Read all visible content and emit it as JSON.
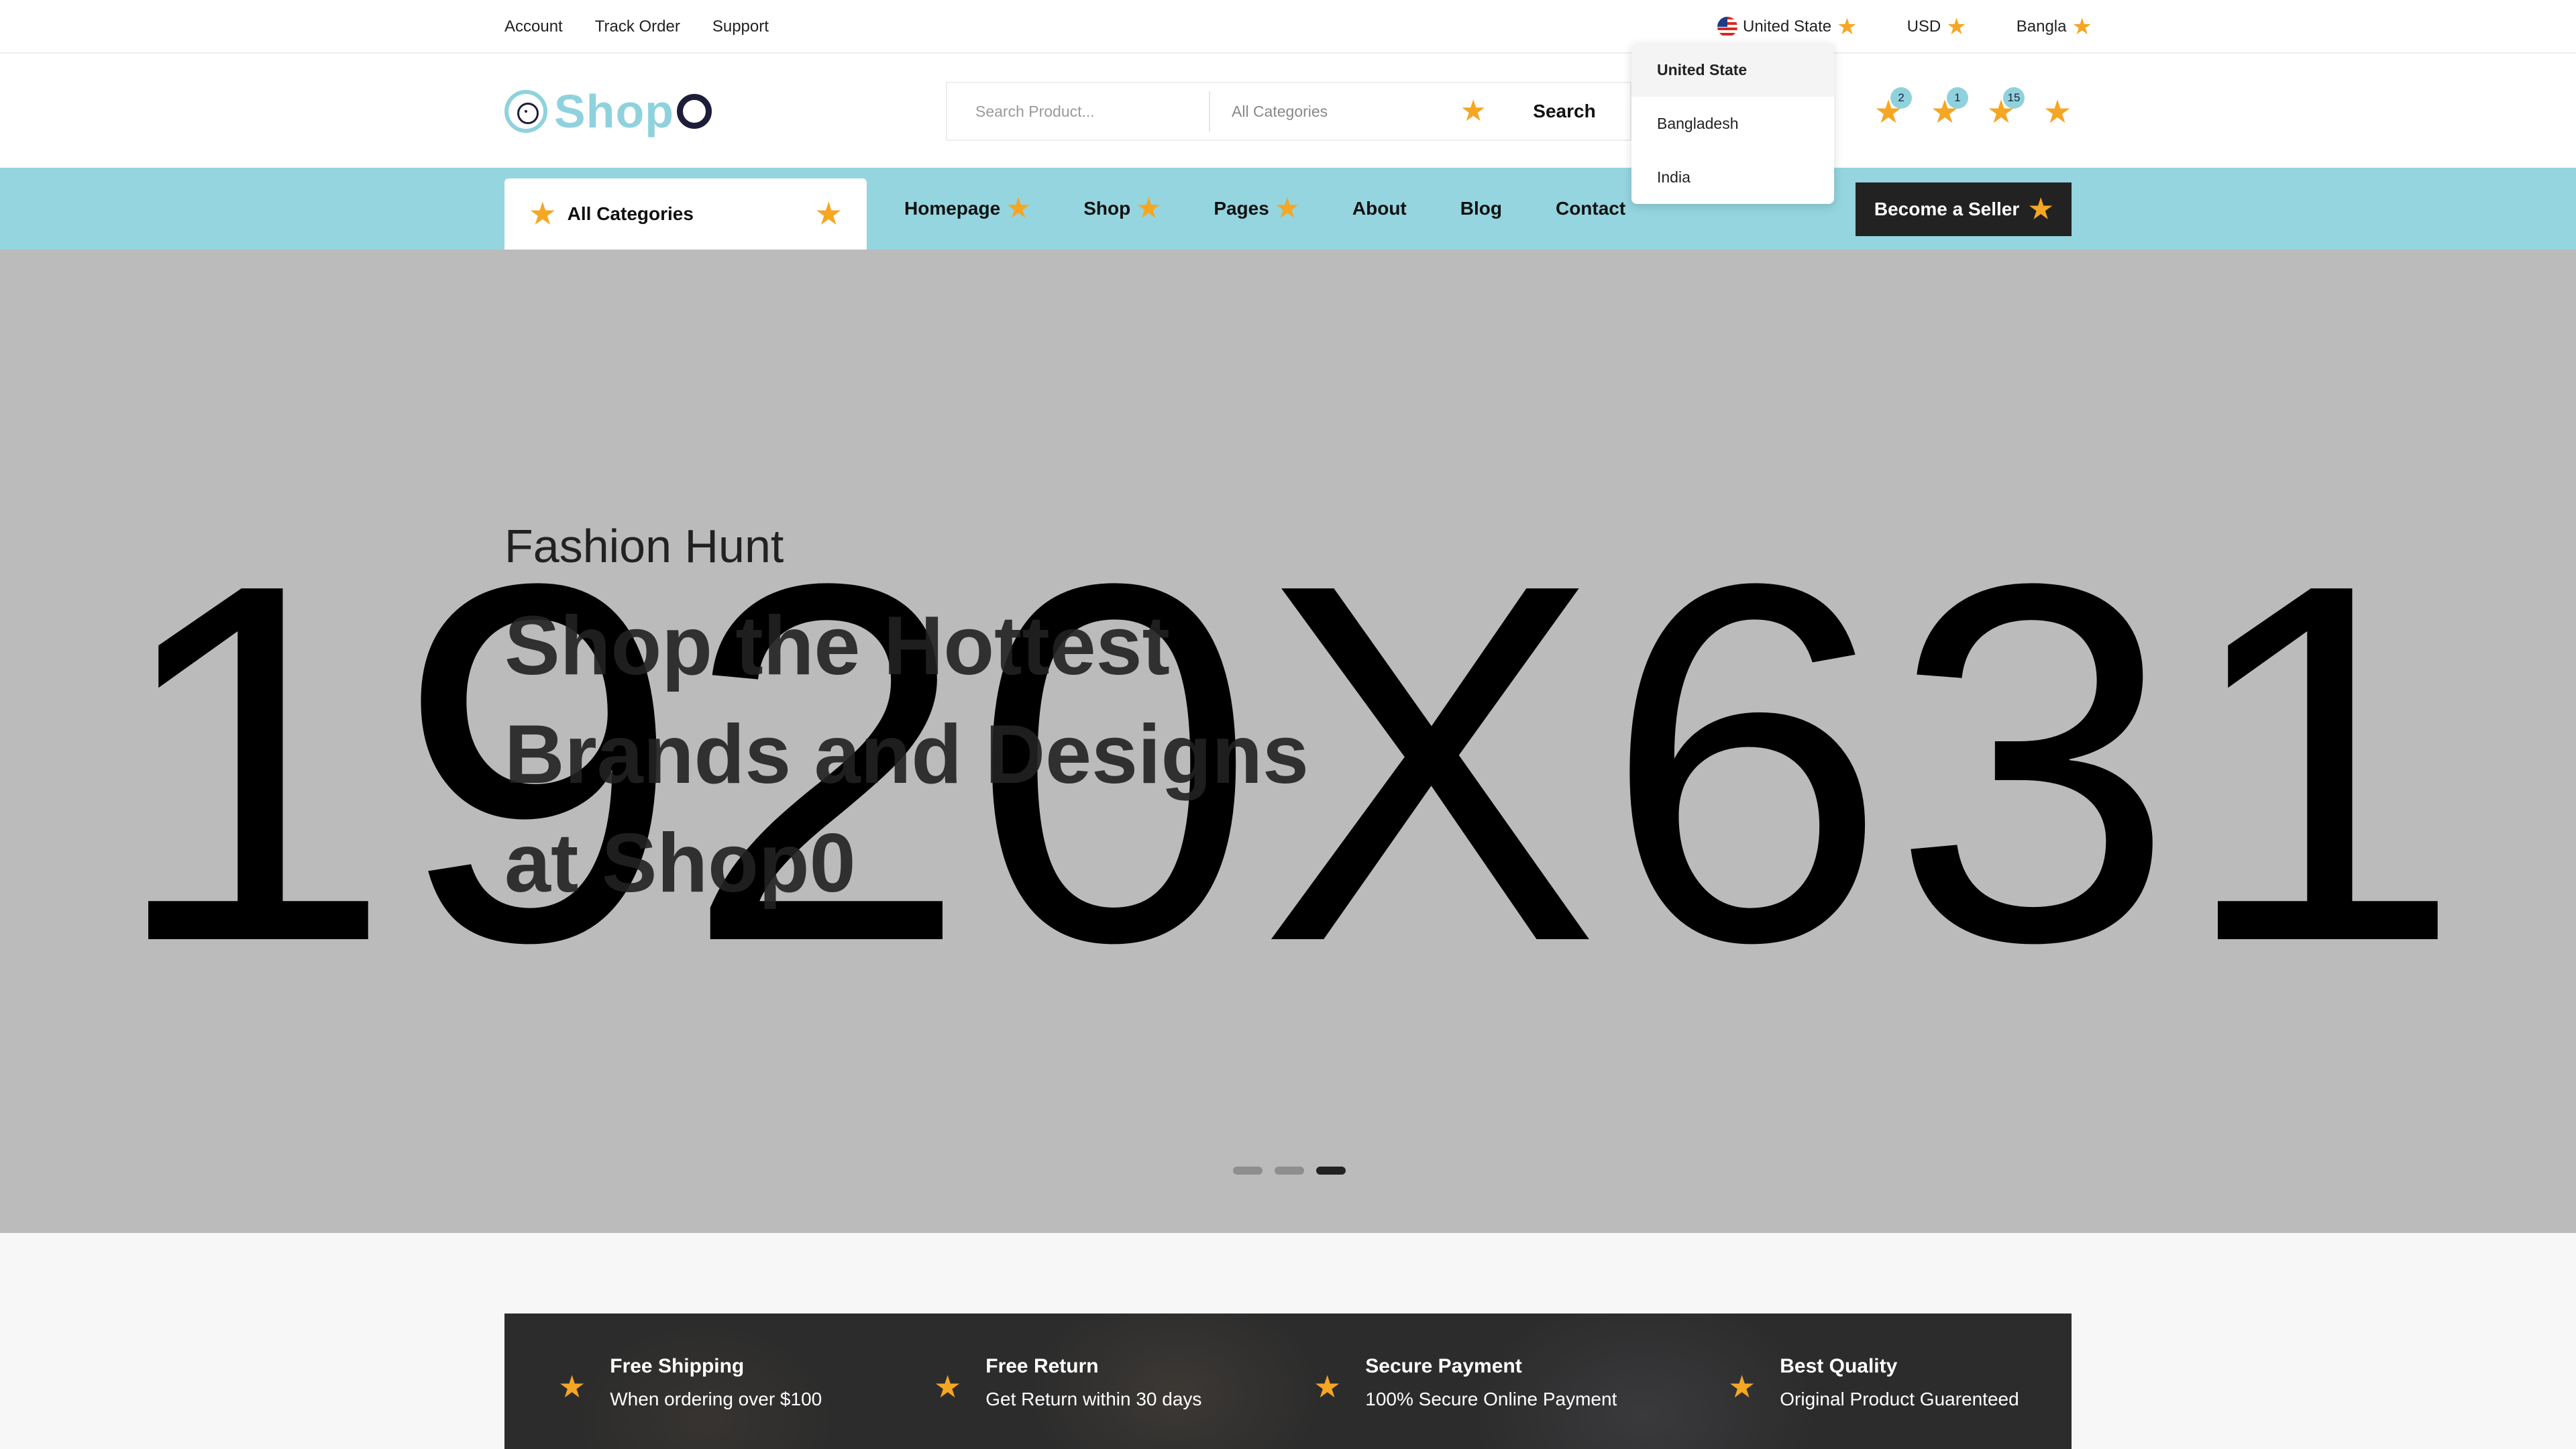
{
  "topbar": {
    "links": [
      "Account",
      "Track Order",
      "Support"
    ],
    "country": "United State",
    "currency": "USD",
    "language": "Bangla"
  },
  "country_dropdown": {
    "options": [
      "United State",
      "Bangladesh",
      "India"
    ],
    "selected": "United State"
  },
  "header": {
    "logo_text": "Shop",
    "search": {
      "placeholder": "Search Product...",
      "category": "All Categories",
      "button_label": "Search"
    },
    "icon_badges": {
      "compare": "2",
      "wishlist": "1",
      "cart": "15"
    },
    "icon_names": [
      "compare-icon",
      "wishlist-icon",
      "cart-icon",
      "user-icon"
    ]
  },
  "nav": {
    "all_categories": "All Categories",
    "links": [
      "Homepage",
      "Shop",
      "Pages",
      "About",
      "Blog",
      "Contact"
    ],
    "seller_button": "Become a Seller"
  },
  "hero": {
    "placeholder_text": "1920X631",
    "subtitle": "Fashion Hunt",
    "title_lines": [
      "Shop the Hottest",
      "Brands and Designs",
      "at Shop0"
    ],
    "slides": 3,
    "active_slide": 3
  },
  "features": [
    {
      "title": "Free Shipping",
      "desc": "When ordering over $100"
    },
    {
      "title": "Free Return",
      "desc": "Get Return within 30 days"
    },
    {
      "title": "Secure Payment",
      "desc": "100% Secure Online Payment"
    },
    {
      "title": "Best Quality",
      "desc": "Original Product Guarenteed"
    }
  ],
  "colors": {
    "accent_teal": "#94D5DF",
    "star": "#F5A623",
    "dark": "#222222",
    "hero_bg": "#BBBBBB"
  }
}
